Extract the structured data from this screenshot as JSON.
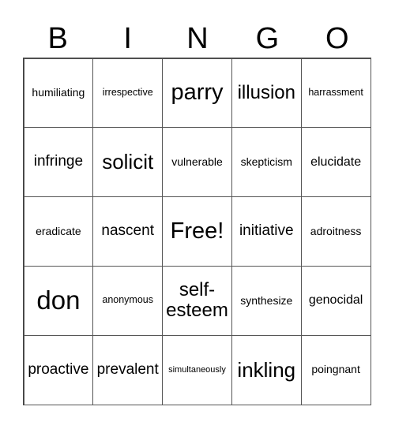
{
  "header": {
    "letters": [
      "B",
      "I",
      "N",
      "G",
      "O"
    ]
  },
  "card": {
    "rows": [
      [
        "humiliating",
        "irrespective",
        "parry",
        "illusion",
        "harrassment"
      ],
      [
        "infringe",
        "solicit",
        "vulnerable",
        "skepticism",
        "elucidate"
      ],
      [
        "eradicate",
        "nascent",
        "Free!",
        "initiative",
        "adroitness"
      ],
      [
        "don",
        "anonymous",
        "self-esteem",
        "synthesize",
        "genocidal"
      ],
      [
        "proactive",
        "prevalent",
        "simultaneously",
        "inkling",
        "poingnant"
      ]
    ]
  }
}
